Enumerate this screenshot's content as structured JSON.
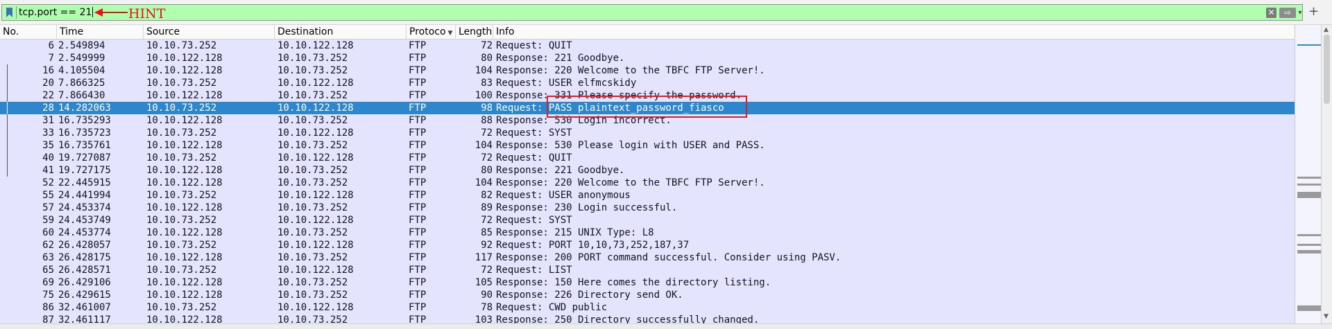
{
  "filter": {
    "value": "tcp.port == 21",
    "clear_glyph": "✕",
    "apply_glyph": "⇨",
    "dropdown_glyph": "▾",
    "add_glyph": "+"
  },
  "annotation": {
    "label": "HINT",
    "color": "#e8101a"
  },
  "columns": [
    {
      "key": "no",
      "label": "No."
    },
    {
      "key": "time",
      "label": "Time"
    },
    {
      "key": "source",
      "label": "Source"
    },
    {
      "key": "destination",
      "label": "Destination"
    },
    {
      "key": "protocol",
      "label": "Protoco"
    },
    {
      "key": "length",
      "label": "Length"
    },
    {
      "key": "info",
      "label": "Info"
    }
  ],
  "colors": {
    "row_bg": "#e4e4ff",
    "selected_bg": "#2d87cd",
    "filter_ok": "#afffaf"
  },
  "packets": [
    {
      "no": "6",
      "time": "2.549894",
      "src": "10.10.73.252",
      "dst": "10.10.122.128",
      "proto": "FTP",
      "len": "72",
      "info": "Request: QUIT",
      "conv": false
    },
    {
      "no": "7",
      "time": "2.549999",
      "src": "10.10.122.128",
      "dst": "10.10.73.252",
      "proto": "FTP",
      "len": "80",
      "info": "Response: 221 Goodbye.",
      "conv": false
    },
    {
      "no": "16",
      "time": "4.105504",
      "src": "10.10.122.128",
      "dst": "10.10.73.252",
      "proto": "FTP",
      "len": "104",
      "info": "Response: 220 Welcome to the TBFC FTP Server!.",
      "conv": true
    },
    {
      "no": "20",
      "time": "7.866325",
      "src": "10.10.73.252",
      "dst": "10.10.122.128",
      "proto": "FTP",
      "len": "83",
      "info": "Request: USER elfmcskidy",
      "conv": true
    },
    {
      "no": "22",
      "time": "7.866430",
      "src": "10.10.122.128",
      "dst": "10.10.73.252",
      "proto": "FTP",
      "len": "100",
      "info": "Response: 331 Please specify the password.",
      "conv": true
    },
    {
      "no": "28",
      "time": "14.282063",
      "src": "10.10.73.252",
      "dst": "10.10.122.128",
      "proto": "FTP",
      "len": "98",
      "info": "Request: PASS plaintext_password_fiasco",
      "conv": true,
      "selected": true
    },
    {
      "no": "31",
      "time": "16.735293",
      "src": "10.10.122.128",
      "dst": "10.10.73.252",
      "proto": "FTP",
      "len": "88",
      "info": "Response: 530 Login incorrect.",
      "conv": true
    },
    {
      "no": "33",
      "time": "16.735723",
      "src": "10.10.73.252",
      "dst": "10.10.122.128",
      "proto": "FTP",
      "len": "72",
      "info": "Request: SYST",
      "conv": true
    },
    {
      "no": "35",
      "time": "16.735761",
      "src": "10.10.122.128",
      "dst": "10.10.73.252",
      "proto": "FTP",
      "len": "104",
      "info": "Response: 530 Please login with USER and PASS.",
      "conv": true
    },
    {
      "no": "40",
      "time": "19.727087",
      "src": "10.10.73.252",
      "dst": "10.10.122.128",
      "proto": "FTP",
      "len": "72",
      "info": "Request: QUIT",
      "conv": true
    },
    {
      "no": "41",
      "time": "19.727175",
      "src": "10.10.122.128",
      "dst": "10.10.73.252",
      "proto": "FTP",
      "len": "80",
      "info": "Response: 221 Goodbye.",
      "conv": true
    },
    {
      "no": "52",
      "time": "22.445915",
      "src": "10.10.122.128",
      "dst": "10.10.73.252",
      "proto": "FTP",
      "len": "104",
      "info": "Response: 220 Welcome to the TBFC FTP Server!.",
      "conv": false
    },
    {
      "no": "55",
      "time": "24.441994",
      "src": "10.10.73.252",
      "dst": "10.10.122.128",
      "proto": "FTP",
      "len": "82",
      "info": "Request: USER anonymous",
      "conv": false
    },
    {
      "no": "57",
      "time": "24.453374",
      "src": "10.10.122.128",
      "dst": "10.10.73.252",
      "proto": "FTP",
      "len": "89",
      "info": "Response: 230 Login successful.",
      "conv": false
    },
    {
      "no": "59",
      "time": "24.453749",
      "src": "10.10.73.252",
      "dst": "10.10.122.128",
      "proto": "FTP",
      "len": "72",
      "info": "Request: SYST",
      "conv": false
    },
    {
      "no": "60",
      "time": "24.453774",
      "src": "10.10.122.128",
      "dst": "10.10.73.252",
      "proto": "FTP",
      "len": "85",
      "info": "Response: 215 UNIX Type: L8",
      "conv": false
    },
    {
      "no": "62",
      "time": "26.428057",
      "src": "10.10.73.252",
      "dst": "10.10.122.128",
      "proto": "FTP",
      "len": "92",
      "info": "Request: PORT 10,10,73,252,187,37",
      "conv": false
    },
    {
      "no": "63",
      "time": "26.428175",
      "src": "10.10.122.128",
      "dst": "10.10.73.252",
      "proto": "FTP",
      "len": "117",
      "info": "Response: 200 PORT command successful. Consider using PASV.",
      "conv": false
    },
    {
      "no": "65",
      "time": "26.428571",
      "src": "10.10.73.252",
      "dst": "10.10.122.128",
      "proto": "FTP",
      "len": "72",
      "info": "Request: LIST",
      "conv": false
    },
    {
      "no": "69",
      "time": "26.429106",
      "src": "10.10.122.128",
      "dst": "10.10.73.252",
      "proto": "FTP",
      "len": "105",
      "info": "Response: 150 Here comes the directory listing.",
      "conv": false
    },
    {
      "no": "75",
      "time": "26.429615",
      "src": "10.10.122.128",
      "dst": "10.10.73.252",
      "proto": "FTP",
      "len": "90",
      "info": "Response: 226 Directory send OK.",
      "conv": false
    },
    {
      "no": "86",
      "time": "32.461007",
      "src": "10.10.73.252",
      "dst": "10.10.122.128",
      "proto": "FTP",
      "len": "78",
      "info": "Request: CWD public",
      "conv": false
    },
    {
      "no": "87",
      "time": "32.461117",
      "src": "10.10.122.128",
      "dst": "10.10.73.252",
      "proto": "FTP",
      "len": "103",
      "info": "Response: 250 Directory successfully changed.",
      "conv": false
    }
  ]
}
